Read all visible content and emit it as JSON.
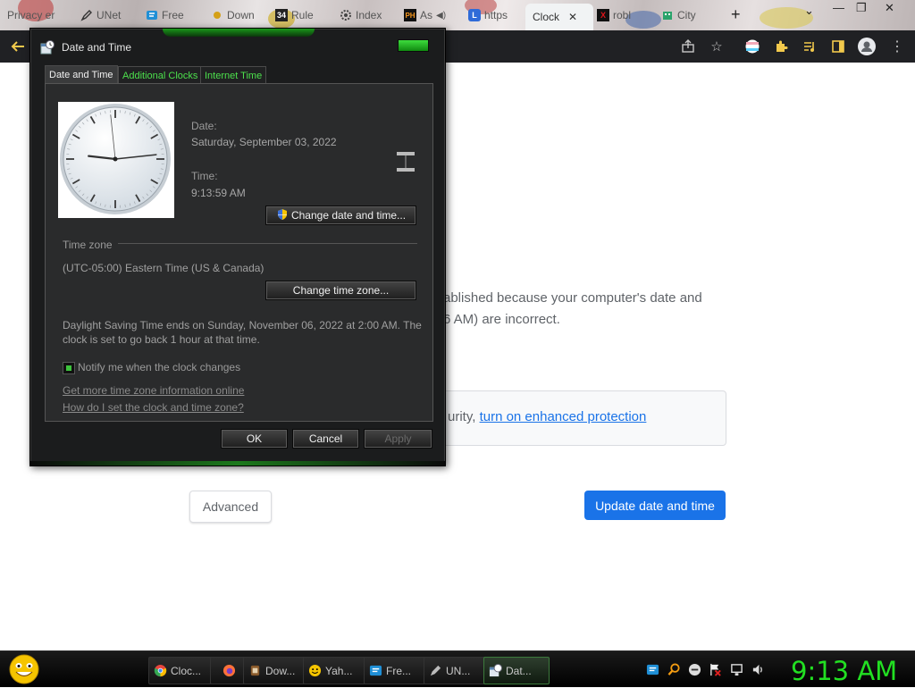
{
  "browser": {
    "tabs": [
      {
        "label": "Privacy er",
        "icon": "globe-icon",
        "color": "#7a7a7a"
      },
      {
        "label": "UNet",
        "icon": "pen-icon",
        "color": "#333333"
      },
      {
        "label": "Free",
        "icon": "stack-icon",
        "color": "#1f8fd6"
      },
      {
        "label": "Down",
        "icon": "drop-icon",
        "color": "#d4a017"
      },
      {
        "label": "Rule",
        "icon": "34-icon",
        "color": "#222222",
        "badge": "34"
      },
      {
        "label": "Index",
        "icon": "gear-icon",
        "color": "#444444"
      },
      {
        "label": "As",
        "icon": "ph-icon",
        "color": "#f7971e",
        "badge": "PH"
      },
      {
        "label": "https",
        "icon": "l-icon",
        "color": "#2f6bd8",
        "badge": "L"
      },
      {
        "label": "Clock",
        "icon": "clock-icon",
        "color": "#333333",
        "active": true
      },
      {
        "label": "robl",
        "icon": "x-icon",
        "color": "#c0161b",
        "badge": "X"
      },
      {
        "label": "City",
        "icon": "city-icon",
        "color": "#2aa36b"
      }
    ],
    "new_tab_label": "+",
    "window_controls": {
      "chevron": "⌄",
      "minimize": "—",
      "maximize": "❐",
      "close": "✕"
    }
  },
  "page": {
    "error_line1": "ablished because your computer's date and",
    "error_line2": "6 AM) are incorrect.",
    "protect_text": "urity, ",
    "protect_link": "turn on enhanced protection",
    "advanced_label": "Advanced",
    "update_label": "Update date and time"
  },
  "dialog": {
    "title": "Date and Time",
    "tabs": [
      "Date and Time",
      "Additional Clocks",
      "Internet Time"
    ],
    "date_label": "Date:",
    "date_value": "Saturday, September 03, 2022",
    "time_label": "Time:",
    "time_value": "9:13:59 AM",
    "change_datetime_label": "Change date and time...",
    "timezone_heading": "Time zone",
    "timezone_value": "(UTC-05:00) Eastern Time (US & Canada)",
    "change_timezone_label": "Change time zone...",
    "dst_line1": "Daylight Saving Time ends on Sunday, November 06, 2022 at 2:00 AM. The",
    "dst_line2": "clock is set to go back 1 hour at that time.",
    "notify_label": "Notify me when the clock changes",
    "notify_checked": true,
    "link1": "Get more time zone information online",
    "link2": "How do I set the clock and time zone?",
    "ok_label": "OK",
    "cancel_label": "Cancel",
    "apply_label": "Apply",
    "clock": {
      "hour": 9,
      "minute": 13,
      "second": 59
    }
  },
  "taskbar": {
    "items": [
      {
        "label": "Cloc...",
        "icon": "chrome-icon",
        "color": "#e8453c"
      },
      {
        "label": "",
        "icon": "firefox-icon",
        "color": "#ff7139"
      },
      {
        "label": "Dow...",
        "icon": "download-icon",
        "color": "#8a5a2b"
      },
      {
        "label": "Yah...",
        "icon": "smiley-icon",
        "color": "#f5c400"
      },
      {
        "label": "Fre...",
        "icon": "stack-icon",
        "color": "#1f8fd6"
      },
      {
        "label": "UN...",
        "icon": "pen-icon",
        "color": "#bbbbbb"
      },
      {
        "label": "Dat...",
        "icon": "datetime-icon",
        "color": "#9ab4cc",
        "active": true
      }
    ],
    "clock": "9:13 AM"
  }
}
